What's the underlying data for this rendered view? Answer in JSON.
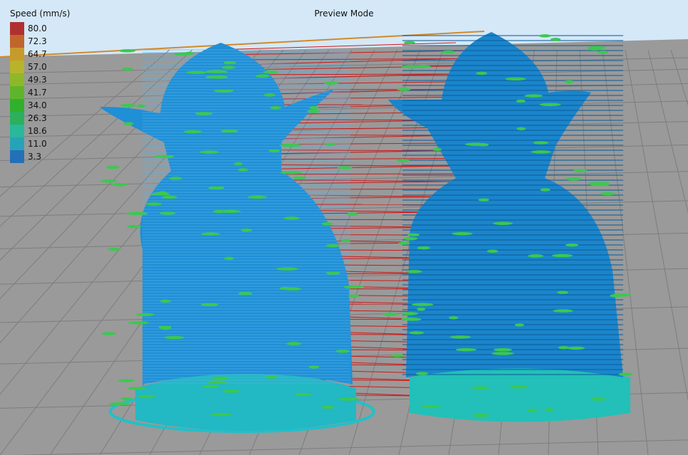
{
  "view": {
    "mode_title": "Preview Mode"
  },
  "legend": {
    "title": "Speed (mm/s)",
    "items": [
      {
        "label": "80.0",
        "color": "#b03030"
      },
      {
        "label": "72.3",
        "color": "#c0652c"
      },
      {
        "label": "64.7",
        "color": "#c79a2c"
      },
      {
        "label": "57.0",
        "color": "#b8b42a"
      },
      {
        "label": "49.3",
        "color": "#8eb82a"
      },
      {
        "label": "41.7",
        "color": "#5fb52a"
      },
      {
        "label": "34.0",
        "color": "#30b02c"
      },
      {
        "label": "26.3",
        "color": "#2cb05c"
      },
      {
        "label": "18.6",
        "color": "#2ab89a"
      },
      {
        "label": "11.0",
        "color": "#27a3b8"
      },
      {
        "label": "3.3",
        "color": "#2470b8"
      }
    ]
  },
  "scene": {
    "sky_color": "#d4e8f8",
    "bed_color": "#9a9a9a",
    "grid_color": "#7a7a7a",
    "travel_color": "#d01818",
    "model_body_color": "#1f8fd6",
    "model_base_color": "#22c0c8",
    "perimeter_color": "#3cc850",
    "models": [
      "yoda-left",
      "yoda-right"
    ]
  }
}
